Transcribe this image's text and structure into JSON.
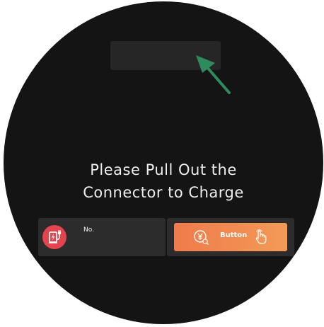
{
  "message": {
    "line1": "Please Pull Out the",
    "line2": "Connector to Charge"
  },
  "connector": {
    "icon": "charging-connector-icon",
    "label": "No."
  },
  "action": {
    "label": "Button",
    "leading_icon": "yen-payment-icon",
    "trailing_icon": "tap-hand-icon"
  },
  "annotation": {
    "arrow_icon": "pointer-arrow-icon"
  },
  "colors": {
    "screen_background": "#141414",
    "panel_background": "#2c2c2c",
    "top_placeholder": "#262626",
    "badge_red": "#e4444d",
    "button_gradient_start": "#ef7b4b",
    "button_gradient_end": "#f39a56",
    "arrow_green": "#2e8b5e",
    "text": "#eeeeee"
  }
}
